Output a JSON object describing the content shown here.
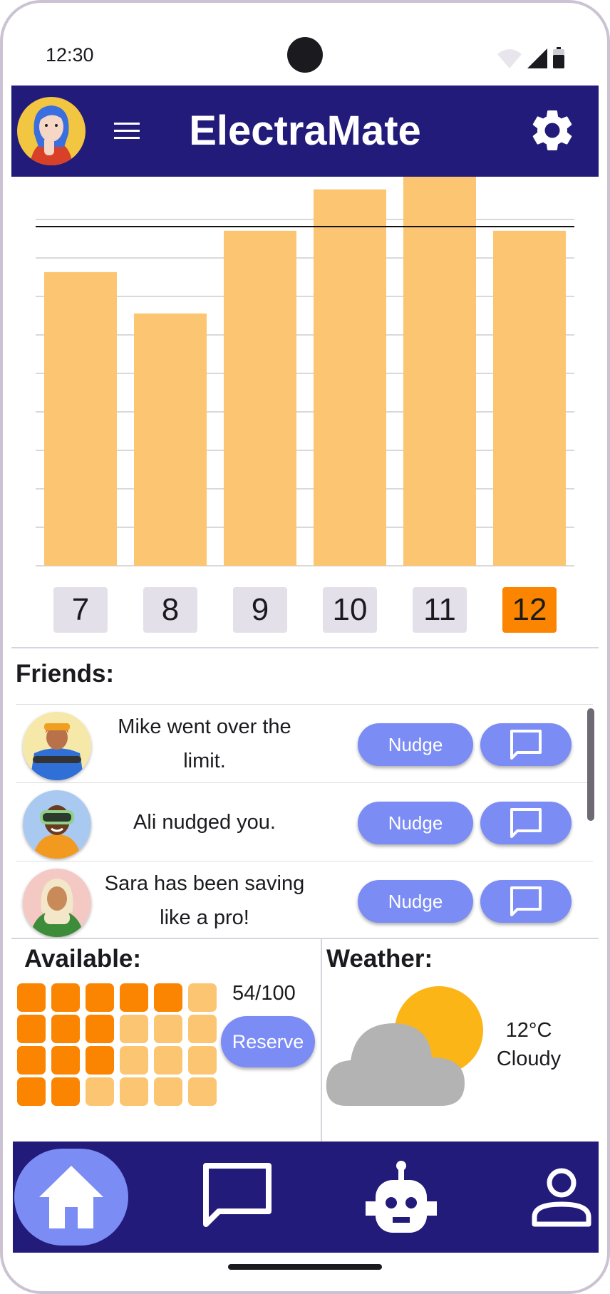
{
  "status_bar": {
    "time": "12:30"
  },
  "header": {
    "title": "ElectraMate"
  },
  "chart_data": {
    "type": "bar",
    "categories": [
      "7",
      "8",
      "9",
      "10",
      "11",
      "12"
    ],
    "values": [
      7.1,
      6.1,
      8.1,
      9.1,
      9.8,
      8.1
    ],
    "highlighted_category": "12",
    "reference_line": 8.2,
    "ylim": [
      0,
      9.2
    ],
    "grid": true,
    "title": "",
    "xlabel": "",
    "ylabel": ""
  },
  "friends": {
    "title": "Friends:",
    "items": [
      {
        "text": "Mike went over the limit.",
        "nudge_label": "Nudge"
      },
      {
        "text": "Ali nudged you.",
        "nudge_label": "Nudge"
      },
      {
        "text": "Sara has been saving like a pro!",
        "nudge_label": "Nudge"
      }
    ]
  },
  "available": {
    "title": "Available:",
    "used": 12,
    "total_slots": 24,
    "count_text": "54/100",
    "reserve_label": "Reserve"
  },
  "weather": {
    "title": "Weather:",
    "temperature": "12°C",
    "condition": "Cloudy"
  },
  "colors": {
    "primary": "#221b7a",
    "accent": "#7b8cf5",
    "bar": "#fcc572",
    "highlight": "#fb8500",
    "slot_used": "#fb8500",
    "slot_free": "#fcc572"
  },
  "nav": {
    "items": [
      "home-icon",
      "chat-icon",
      "bot-icon",
      "profile-icon"
    ],
    "active": "home-icon"
  }
}
